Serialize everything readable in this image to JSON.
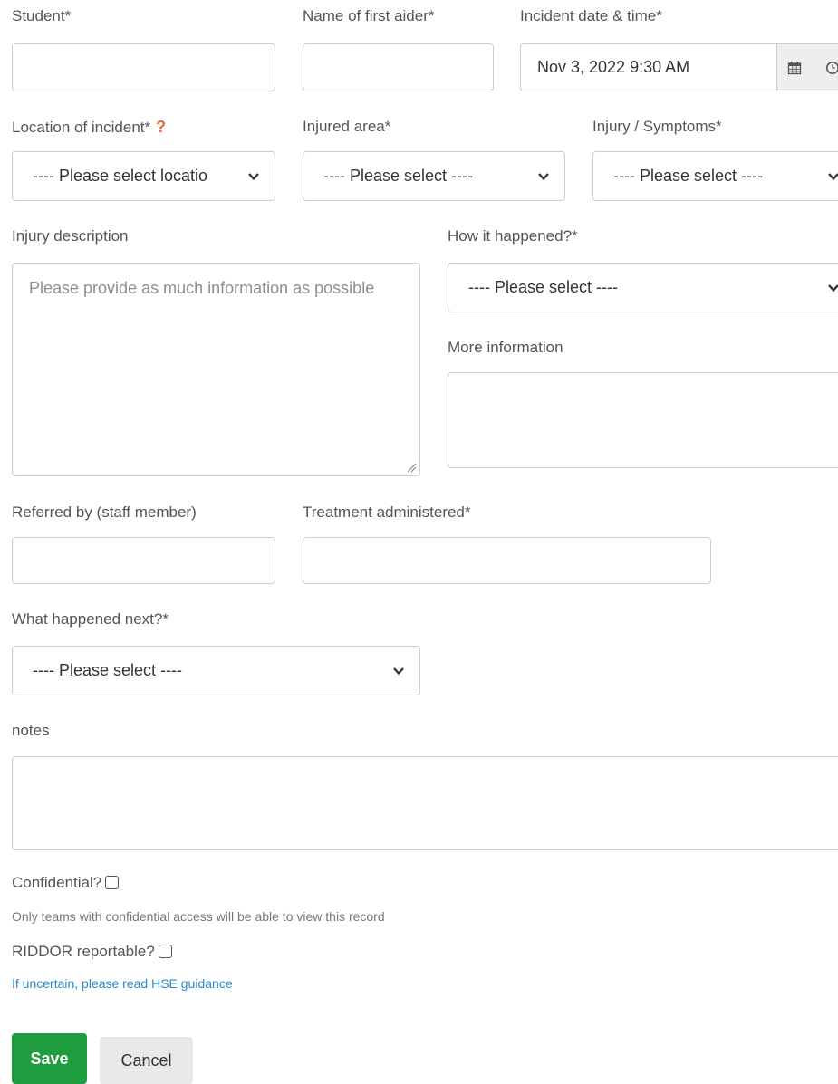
{
  "form": {
    "student": {
      "label": "Student*",
      "value": ""
    },
    "first_aider": {
      "label": "Name of first aider*",
      "value": ""
    },
    "incident_datetime": {
      "label": "Incident date & time*",
      "value": "Nov 3, 2022 9:30 AM",
      "calendar_icon": "calendar-icon",
      "clock_icon": "clock-icon"
    },
    "location": {
      "label": "Location of incident*",
      "help_icon": "?",
      "selected": "---- Please select locatio"
    },
    "injured_area": {
      "label": "Injured area*",
      "selected": "---- Please select ----"
    },
    "injury_symptoms": {
      "label": "Injury / Symptoms*",
      "selected": "---- Please select ----"
    },
    "injury_description": {
      "label": "Injury description",
      "placeholder": "Please provide as much information as possible",
      "value": ""
    },
    "how_it_happened": {
      "label": "How it happened?*",
      "selected": "---- Please select ----"
    },
    "more_information": {
      "label": "More information",
      "value": ""
    },
    "referred_by": {
      "label": "Referred by (staff member)",
      "value": ""
    },
    "treatment": {
      "label": "Treatment administered*",
      "value": ""
    },
    "what_next": {
      "label": "What happened next?*",
      "selected": "---- Please select ----"
    },
    "notes": {
      "label": "notes",
      "value": ""
    },
    "confidential": {
      "label": "Confidential?",
      "checked": false,
      "help": "Only teams with confidential access will be able to view this record"
    },
    "riddor": {
      "label": "RIDDOR reportable?",
      "checked": false,
      "help_link": "If uncertain, please read HSE guidance"
    }
  },
  "actions": {
    "save_label": "Save",
    "cancel_label": "Cancel"
  },
  "colors": {
    "save": "#1e9d3f",
    "link": "#2a8ac9",
    "help_icon": "#f0643c"
  }
}
